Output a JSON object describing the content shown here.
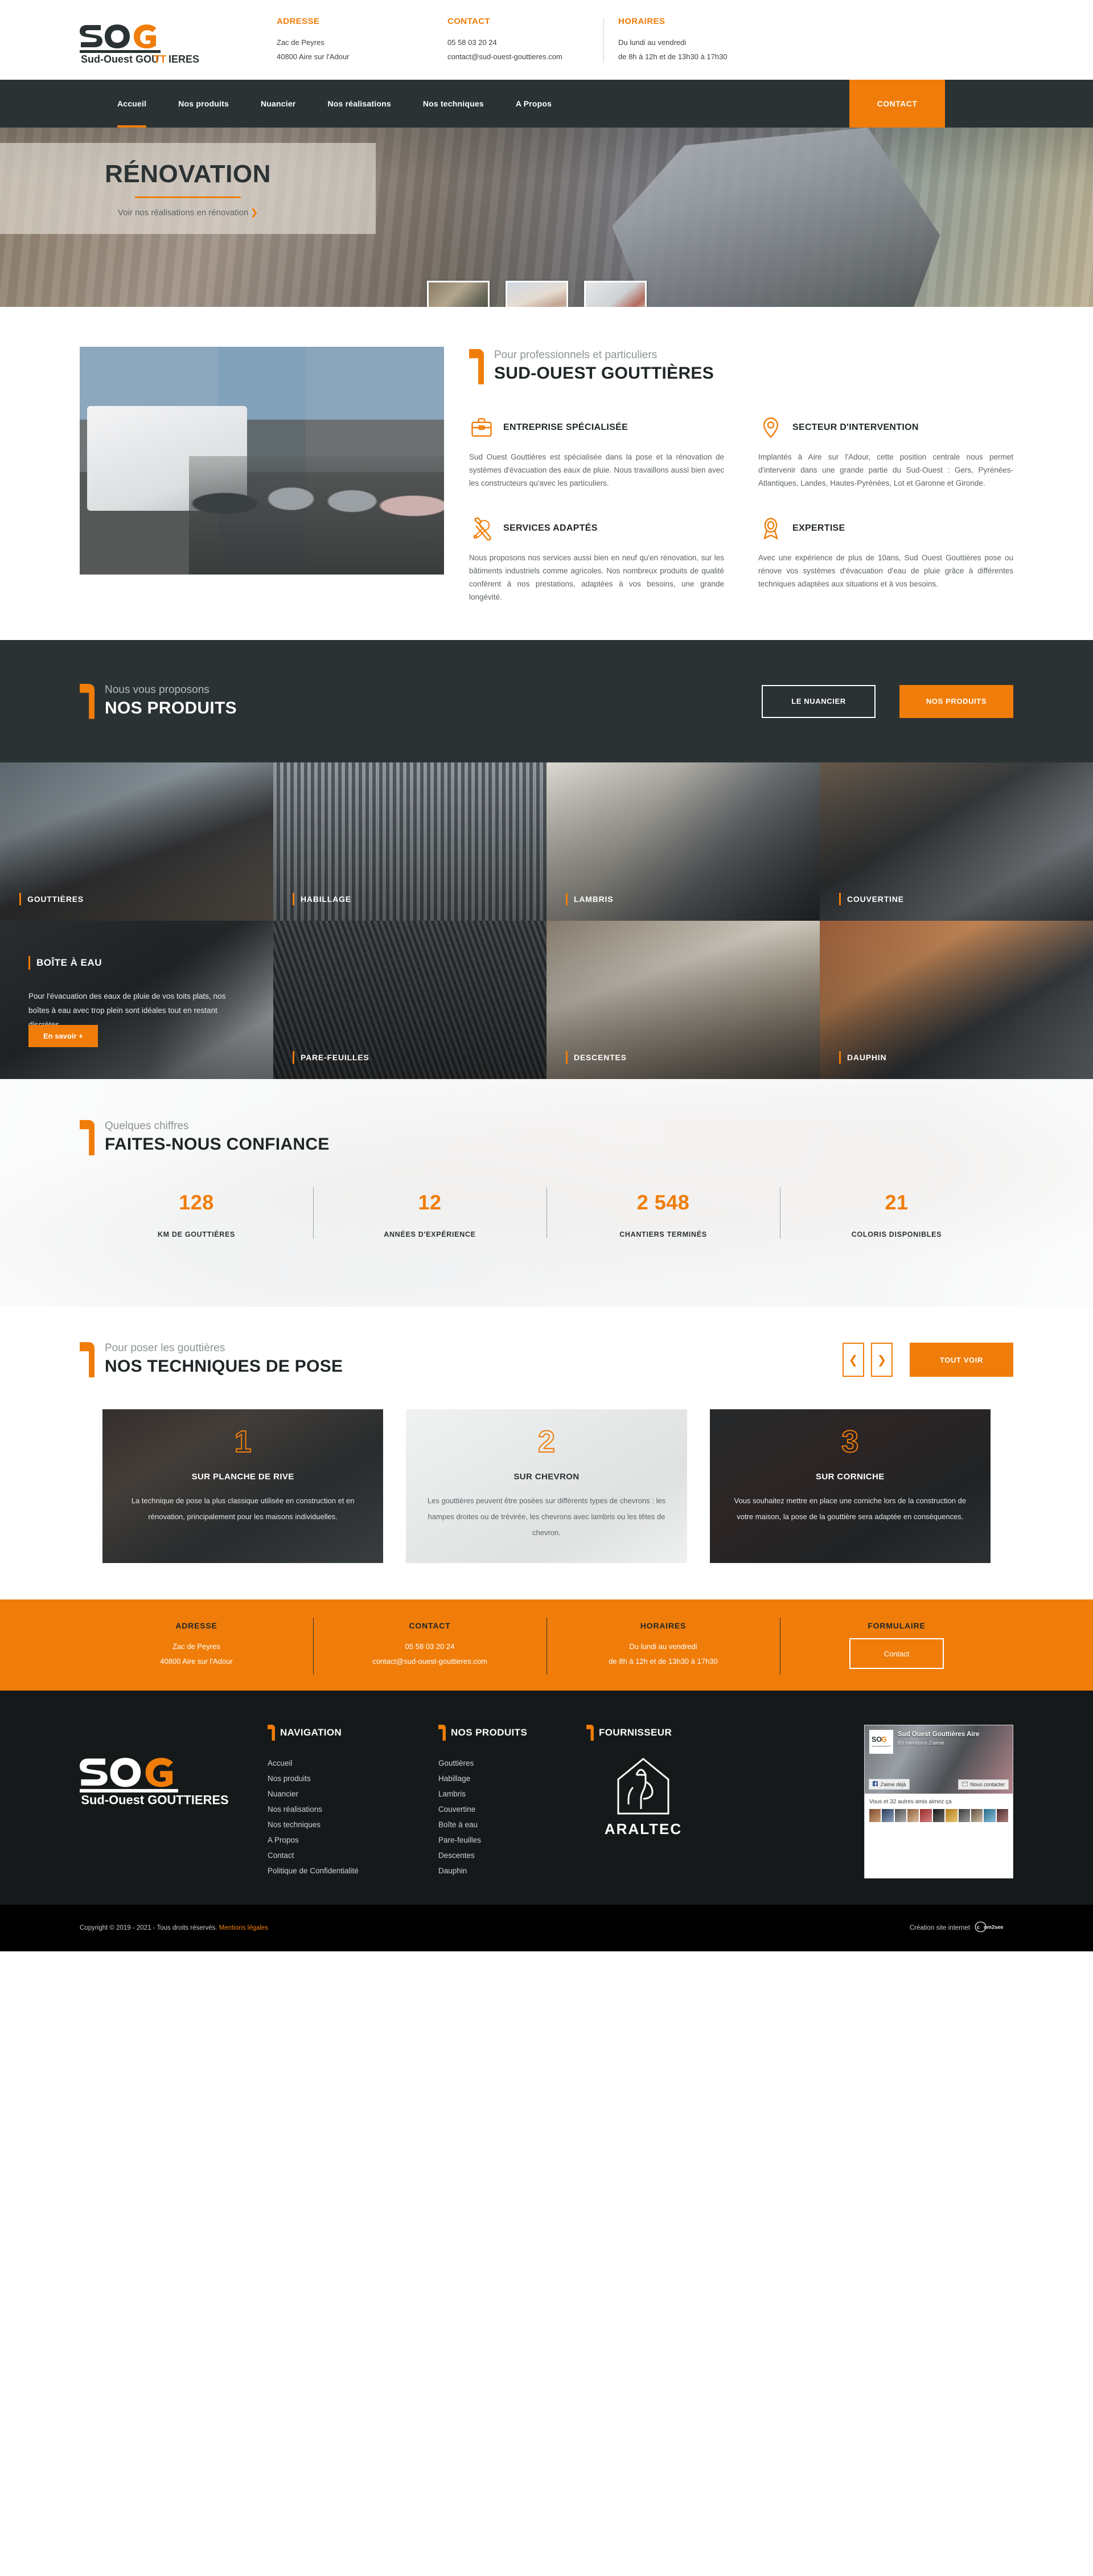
{
  "brand": {
    "name": "SOG",
    "tagline": "Sud-Ouest GOUTTIÈRES",
    "accent": "#f07d0a",
    "dark": "#2b3233"
  },
  "topbar": {
    "columns": [
      {
        "title": "ADRESSE",
        "lines": [
          "Zac de Peyres",
          "40800 Aire sur l'Adour"
        ]
      },
      {
        "title": "CONTACT",
        "lines": [
          "05 58 03 20 24",
          "contact@sud-ouest-gouttieres.com"
        ]
      },
      {
        "title": "HORAIRES",
        "lines": [
          "Du lundi au vendredi",
          "de 8h à 12h et de 13h30 à 17h30"
        ]
      }
    ]
  },
  "nav": {
    "items": [
      "Accueil",
      "Nos produits",
      "Nuancier",
      "Nos réalisations",
      "Nos techniques",
      "A Propos"
    ],
    "active": "Accueil",
    "cta": "CONTACT"
  },
  "hero": {
    "title": "RÉNOVATION",
    "subtitle": "Voir nos réalisations en rénovation",
    "chevron": "❯",
    "thumbs": [
      "thumb-renovation",
      "thumb-construction-neuve",
      "thumb-batiment-industriel"
    ]
  },
  "about": {
    "supertitle": "Pour professionnels et particuliers",
    "title": "SUD-OUEST GOUTTIÈRES",
    "features": [
      {
        "icon": "briefcase-icon",
        "title": "ENTREPRISE SPÉCIALISÉE",
        "text": "Sud Ouest Gouttières est spécialisée dans la pose et la rénovation de systèmes d'évacuation des eaux de pluie. Nous travaillons aussi bien avec les constructeurs qu'avec les particuliers."
      },
      {
        "icon": "map-pin-icon",
        "title": "SECTEUR D'INTERVENTION",
        "text": "Implantés à Aire sur l'Adour, cette position centrale nous permet d'intervenir dans une grande partie du Sud-Ouest : Gers, Pyrénées-Atlantiques, Landes, Hautes-Pyrénées, Lot et Garonne et Gironde."
      },
      {
        "icon": "tools-icon",
        "title": "SERVICES ADAPTÉS",
        "text": "Nous proposons nos services aussi bien en neuf qu'en rénovation, sur les bâtiments industriels comme agricoles. Nos nombreux produits de qualité confèrent à nos prestations, adaptées à vos besoins, une grande longévité."
      },
      {
        "icon": "award-icon",
        "title": "EXPERTISE",
        "text": "Avec une expérience de plus de 10ans, Sud Ouest Gouttières pose ou rénove vos systèmes d'évacuation d'eau de pluie grâce à différentes techniques adaptées aux situations et à vos besoins."
      }
    ]
  },
  "products_band": {
    "supertitle": "Nous vous proposons",
    "title": "NOS PRODUITS",
    "btn_ghost": "LE NUANCIER",
    "btn_primary": "NOS PRODUITS"
  },
  "products": {
    "row1": [
      "GOUTTIÈRES",
      "HABILLAGE",
      "LAMBRIS",
      "COUVERTINE"
    ],
    "featured": {
      "title": "BOÎTE À EAU",
      "text": "Pour l'évacuation des eaux de pluie de vos toits plats, nos boîtes à eau avec trop plein sont idéales tout en restant discrètes.",
      "button": "En savoir +"
    },
    "row2": [
      "PARE-FEUILLES",
      "DESCENTES",
      "DAUPHIN"
    ]
  },
  "stats": {
    "supertitle": "Quelques chiffres",
    "title": "FAITES-NOUS CONFIANCE",
    "items": [
      {
        "value": "128",
        "label": "KM DE GOUTTIÈRES"
      },
      {
        "value": "12",
        "label": "ANNÉES D'EXPÉRIENCE"
      },
      {
        "value": "2 548",
        "label": "CHANTIERS TERMINÉS"
      },
      {
        "value": "21",
        "label": "COLORIS DISPONIBLES"
      }
    ]
  },
  "techniques": {
    "supertitle": "Pour poser les gouttières",
    "title": "NOS TECHNIQUES DE POSE",
    "prev": "❮",
    "next": "❯",
    "see_all": "TOUT VOIR",
    "cards": [
      {
        "number": "1",
        "title": "SUR PLANCHE DE RIVE",
        "text": "La technique de pose la plus classique utilisée en construction et en rénovation, principalement pour les maisons individuelles."
      },
      {
        "number": "2",
        "title": "SUR CHEVRON",
        "text": "Les gouttières peuvent être posées sur différents types de chevrons : les hampes droites ou de trévirée, les chevrons avec lambris ou les têtes de chevron."
      },
      {
        "number": "3",
        "title": "SUR CORNICHE",
        "text": "Vous souhaitez mettre en place une corniche lors de la construction de votre maison, la pose de la gouttière sera adaptée en conséquences."
      }
    ]
  },
  "contact_band": {
    "columns": [
      {
        "title": "ADRESSE",
        "lines": [
          "Zac de Peyres",
          "40800 Aire sur l'Adour"
        ]
      },
      {
        "title": "CONTACT",
        "lines": [
          "05 58 03 20 24",
          "contact@sud-ouest-gouttieres.com"
        ]
      },
      {
        "title": "HORAIRES",
        "lines": [
          "Du lundi au vendredi",
          "de 8h à 12h et de 13h30 à 17h30"
        ]
      }
    ],
    "form": {
      "title": "FORMULAIRE",
      "button": "Contact"
    }
  },
  "footer": {
    "nav": {
      "title": "NAVIGATION",
      "links": [
        "Accueil",
        "Nos produits",
        "Nuancier",
        "Nos réalisations",
        "Nos techniques",
        "A Propos",
        "Contact",
        "Politique de Confidentialité"
      ]
    },
    "products": {
      "title": "NOS PRODUITS",
      "links": [
        "Gouttières",
        "Habillage",
        "Lambris",
        "Couvertine",
        "Boîte à eau",
        "Pare-feuilles",
        "Descentes",
        "Dauphin"
      ]
    },
    "supplier": {
      "title": "FOURNISSEUR",
      "name": "ARALTEC"
    },
    "facebook": {
      "page_name": "Sud Ouest Gouttières Aire",
      "likes": "83 mentions J'aime",
      "like_button": "J'aime déjà",
      "contact_button": "Nous contacter",
      "friends_text": "Vous et 32 autres amis aimez ça"
    },
    "copyright": "Copyright © 2019 - 2021 - Tous droits réservés.",
    "legal_link": "Mentions légales",
    "credit": "Création site internet",
    "credit_brand": "com2see"
  }
}
